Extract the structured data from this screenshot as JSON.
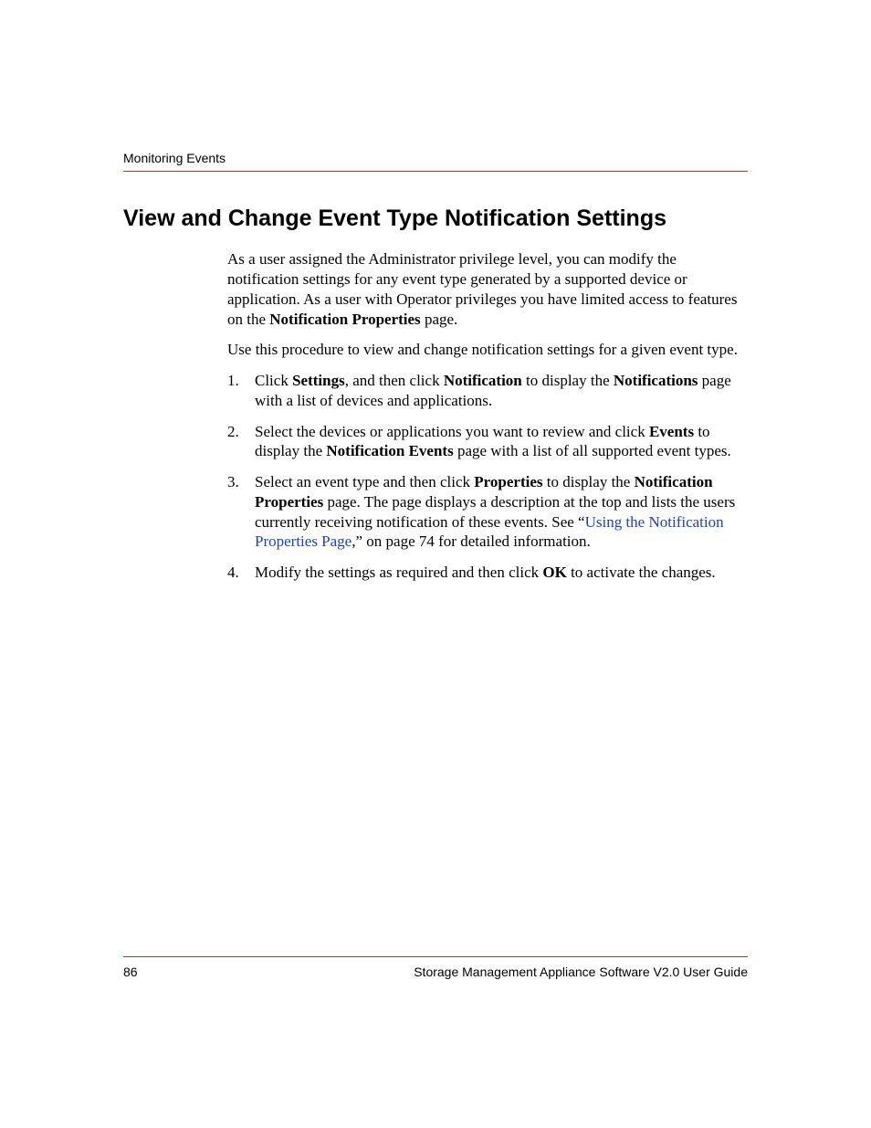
{
  "header": {
    "running": "Monitoring Events"
  },
  "heading": "View and Change Event Type Notification Settings",
  "intro": {
    "p1a": "As a user assigned the Administrator privilege level, you can modify the notification settings for any event type generated by a supported device or application. As a user with Operator privileges you have limited access to features on the ",
    "p1b": "Notification Properties",
    "p1c": " page.",
    "p2": "Use this procedure to view and change notification settings for a given event type."
  },
  "steps": {
    "s1": {
      "a": "Click ",
      "b1": "Settings",
      "c": ", and then click ",
      "b2": "Notification",
      "d": " to display the ",
      "b3": "Notifications",
      "e": " page with a list of devices and applications."
    },
    "s2": {
      "a": "Select the devices or applications you want to review and click ",
      "b1": "Events",
      "c": " to display the ",
      "b2": "Notification Events",
      "d": " page with a list of all supported event types."
    },
    "s3": {
      "a": "Select an event type and then click ",
      "b1": "Properties",
      "c": " to display the ",
      "b2": "Notification Properties",
      "d": " page. The page displays a description at the top and lists the users currently receiving notification of these events. See “",
      "link": "Using the Notification Properties Page",
      "e": ",” on page 74 for detailed information."
    },
    "s4": {
      "a": "Modify the settings as required and then click ",
      "b1": "OK",
      "c": " to activate the changes."
    }
  },
  "footer": {
    "pageNumber": "86",
    "docTitle": "Storage Management Appliance Software V2.0 User Guide"
  }
}
